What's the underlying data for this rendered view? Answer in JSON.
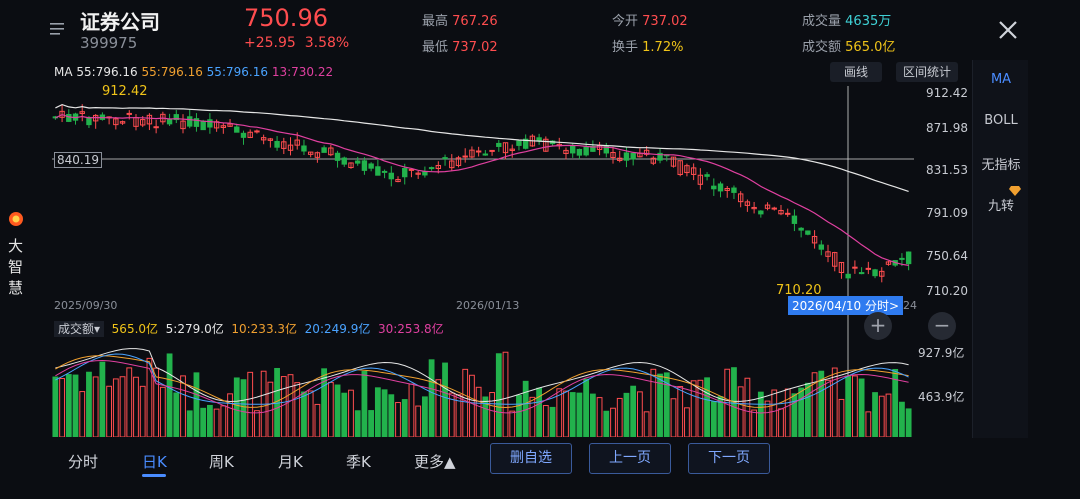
{
  "side": {
    "brand": "大\n智\n慧"
  },
  "header": {
    "title": "证券公司",
    "code": "399975",
    "price": "750.96",
    "change": "+25.95",
    "change_pct": "3.58%",
    "high_label": "最高",
    "high": "767.26",
    "low_label": "最低",
    "low": "737.02",
    "open_label": "今开",
    "open": "737.02",
    "turnover_label": "换手",
    "turnover": "1.72%",
    "volume_label": "成交量",
    "volume": "4635万",
    "amount_label": "成交额",
    "amount": "565.0亿"
  },
  "ma_legend": {
    "label": "MA",
    "ma1": "55:796.16",
    "ma2": "55:796.16",
    "ma3": "55:796.16",
    "ma4": "13:730.22"
  },
  "toolbar": {
    "draw": "画线",
    "range_stats": "区间统计"
  },
  "right_panel": {
    "items": [
      "MA",
      "BOLL",
      "无指标",
      "九转"
    ]
  },
  "price_axis": [
    "912.42",
    "871.98",
    "831.53",
    "791.09",
    "750.64",
    "710.20"
  ],
  "markers": {
    "hline_value": "840.19",
    "max_label": "912.42",
    "min_label": "710.20",
    "cursor_date": "2026/04/10 分时>",
    "right_tick_partial": "24"
  },
  "date_axis": [
    "2025/09/30",
    "2026/01/13"
  ],
  "vol_legend": {
    "selector": "成交额▾",
    "v0": "565.0亿",
    "v5": "5:279.0亿",
    "v10": "10:233.3亿",
    "v20": "20:249.9亿",
    "v30": "30:253.8亿"
  },
  "vol_axis": [
    "927.9亿",
    "463.9亿"
  ],
  "tabs": [
    "分时",
    "日K",
    "周K",
    "月K",
    "季K",
    "更多▲"
  ],
  "buttons": {
    "del_watch": "删自选",
    "prev_page": "上一页",
    "next_page": "下一页"
  },
  "zoom": {
    "plus": "+",
    "minus": "−"
  },
  "colors": {
    "up": "#ff4d4f",
    "down": "#22b24c",
    "accent": "#4a8cff"
  }
}
